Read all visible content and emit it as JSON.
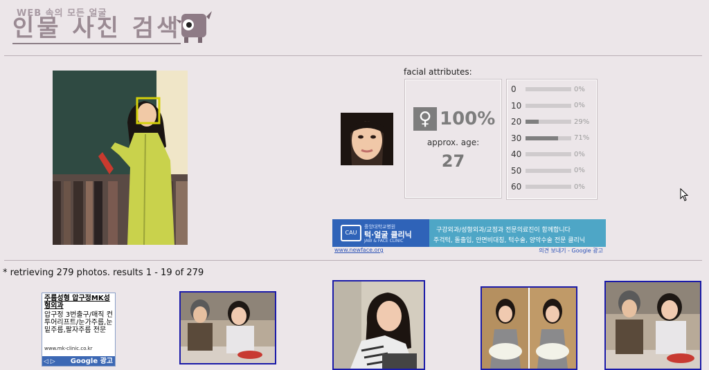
{
  "header": {
    "subtitle": "WEB 속의 모든 얼굴",
    "title": "인물 사진 검색",
    "mascot_icon": "mascot-logo-icon"
  },
  "main_photo": {
    "face_box_color": "#d4d00a"
  },
  "attributes": {
    "label": "facial attributes:",
    "gender_icon": "female-icon",
    "gender_symbol": "♀",
    "gender_percent": "100%",
    "age_label": "approx. age:",
    "age_value": "27",
    "age_distribution": [
      {
        "age": "0",
        "percent": "0%",
        "fraction": 0.0
      },
      {
        "age": "10",
        "percent": "0%",
        "fraction": 0.0
      },
      {
        "age": "20",
        "percent": "29%",
        "fraction": 0.29
      },
      {
        "age": "30",
        "percent": "71%",
        "fraction": 0.71
      },
      {
        "age": "40",
        "percent": "0%",
        "fraction": 0.0
      },
      {
        "age": "50",
        "percent": "0%",
        "fraction": 0.0
      },
      {
        "age": "60",
        "percent": "0%",
        "fraction": 0.0
      }
    ]
  },
  "banner_ad": {
    "badge": "CAU",
    "brand_small": "중앙대학교병원",
    "brand": "턱·얼굴 클리닉",
    "brand_en": "JAW & FACE CLINIC",
    "line1": "구강외과/성형외과/교정과 전문의료진이 함께합니다",
    "line2": "주걱턱, 돌출입, 안면비대칭, 턱수술, 양악수술 전문 클리닉",
    "url": "www.newface.org",
    "google_text": "의견 보내기 - Google 광고"
  },
  "results": {
    "summary": "* retrieving 279 photos. results 1 - 19 of 279"
  },
  "small_ad": {
    "title": "주름성형 압구정MK성형외과",
    "description": "압구정 3번출구/매직 컨투어리프트/눈가주름,눈밑주름,팔자주름 전문",
    "url": "www.mk-clinic.co.kr",
    "arrows": "◁ ▷",
    "google_label": "Google 광고"
  },
  "colors": {
    "background": "#ece6e9",
    "thumb_border": "#1a1aa8",
    "banner_blue": "#2f63b8",
    "banner_cyan": "#4ea6c6"
  }
}
